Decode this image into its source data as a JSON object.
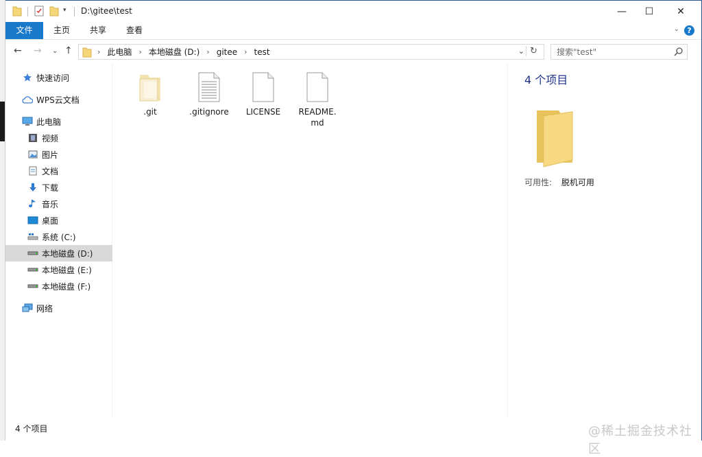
{
  "window": {
    "title": "D:\\gitee\\test",
    "minimize": "—",
    "maximize": "☐",
    "close": "✕"
  },
  "ribbon": {
    "tabs": [
      "文件",
      "主页",
      "共享",
      "查看"
    ],
    "help": "?"
  },
  "address": {
    "crumbs": [
      "此电脑",
      "本地磁盘 (D:)",
      "gitee",
      "test"
    ],
    "search_placeholder": "搜索\"test\""
  },
  "nav": {
    "items": [
      {
        "label": "快速访问",
        "icon": "star-icon"
      },
      {
        "label": "WPS云文档",
        "icon": "cloud-icon"
      },
      {
        "label": "此电脑",
        "icon": "computer-icon"
      },
      {
        "label": "视频",
        "icon": "video-icon"
      },
      {
        "label": "图片",
        "icon": "picture-icon"
      },
      {
        "label": "文档",
        "icon": "document-icon"
      },
      {
        "label": "下载",
        "icon": "download-icon"
      },
      {
        "label": "音乐",
        "icon": "music-icon"
      },
      {
        "label": "桌面",
        "icon": "desktop-icon"
      },
      {
        "label": "系统 (C:)",
        "icon": "system-drive-icon"
      },
      {
        "label": "本地磁盘 (D:)",
        "icon": "drive-icon",
        "selected": true
      },
      {
        "label": "本地磁盘 (E:)",
        "icon": "drive-icon"
      },
      {
        "label": "本地磁盘 (F:)",
        "icon": "drive-icon"
      },
      {
        "label": "网络",
        "icon": "network-icon"
      }
    ]
  },
  "files": [
    {
      "name": ".git",
      "icon": "folder-icon"
    },
    {
      "name": ".gitignore",
      "icon": "text-file-icon"
    },
    {
      "name": "LICENSE",
      "icon": "file-icon"
    },
    {
      "name": "README.md",
      "icon": "file-icon"
    }
  ],
  "preview": {
    "count": "4 个项目",
    "availability_label": "可用性:",
    "availability_value": "脱机可用"
  },
  "status": {
    "count": "4 个项目"
  },
  "watermark": "@稀土掘金技术社区",
  "colors": {
    "accent": "#1979ca",
    "folder": "#f5d77a",
    "selected_nav": "#d9d9d9"
  }
}
